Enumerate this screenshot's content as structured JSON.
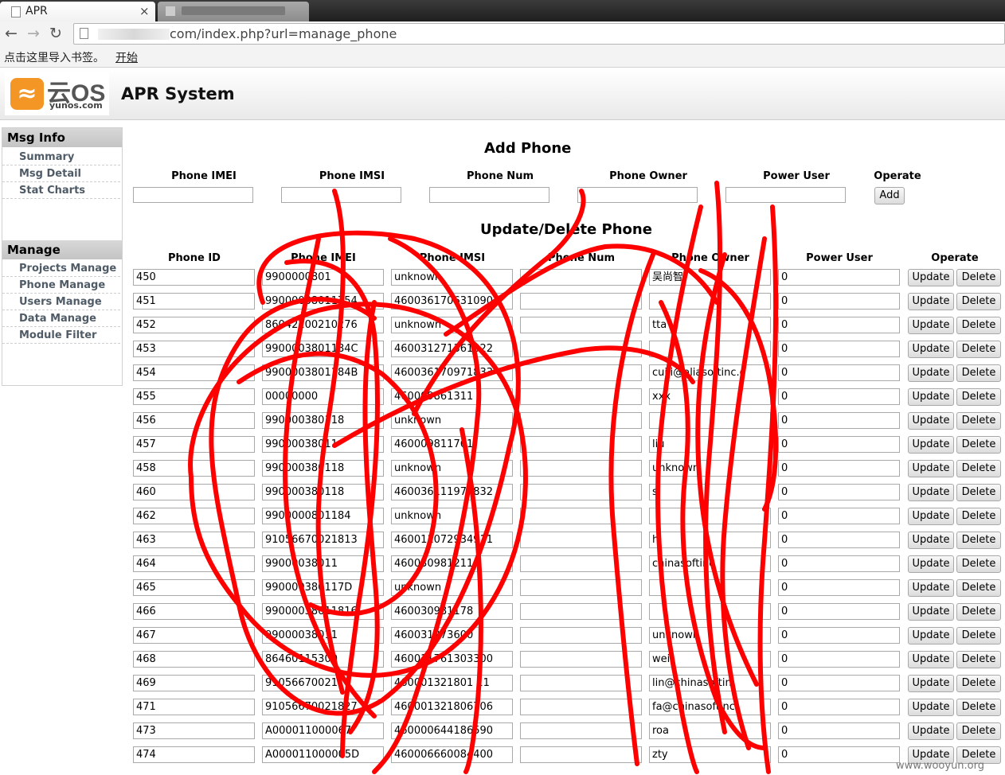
{
  "browser": {
    "tab_title": "APR",
    "tab_close": "×",
    "url": "com/index.php?url=manage_phone",
    "bookmark_prompt": "点击这里导入书签。",
    "bookmark_link": "开始"
  },
  "header": {
    "logo_text": "云OS",
    "logo_sub": "yunos.com",
    "title": "APR System"
  },
  "sidebar": {
    "msg_info_title": "Msg Info",
    "msg_items": [
      "Summary",
      "Msg Detail",
      "Stat Charts"
    ],
    "manage_title": "Manage",
    "manage_items": [
      "Projects Manage",
      "Phone Manage",
      "Users Manage",
      "Data Manage",
      "Module Filter"
    ]
  },
  "add_phone": {
    "title": "Add Phone",
    "columns": [
      "Phone IMEI",
      "Phone IMSI",
      "Phone Num",
      "Phone Owner",
      "Power User",
      "Operate"
    ],
    "add_label": "Add"
  },
  "update_phone": {
    "title": "Update/Delete Phone",
    "columns": [
      "Phone ID",
      "Phone IMEI",
      "Phone IMSI",
      "Phone Num",
      "Phone Owner",
      "Power User",
      "Operate"
    ],
    "update_label": "Update",
    "delete_label": "Delete",
    "rows": [
      {
        "id": "450",
        "imei": "9900000801",
        "imsi": "unknown",
        "num": "",
        "owner": "吴尚智",
        "power": "0"
      },
      {
        "id": "451",
        "imei": "99000038011754",
        "imsi": "460036170631090",
        "num": "",
        "owner": "",
        "power": "0"
      },
      {
        "id": "452",
        "imei": "86042200210276",
        "imsi": "unknown",
        "num": "",
        "owner": "tta",
        "power": "0"
      },
      {
        "id": "453",
        "imei": "9900003801184C",
        "imsi": "460031271361322",
        "num": "",
        "owner": "",
        "power": "0"
      },
      {
        "id": "454",
        "imei": "9900003801184B",
        "imsi": "460036170971833",
        "num": "",
        "owner": "cuiji@aliasoftinc.c",
        "power": "0"
      },
      {
        "id": "455",
        "imei": "00000000",
        "imsi": "460009861311",
        "num": "",
        "owner": "xxx",
        "power": "0"
      },
      {
        "id": "456",
        "imei": "990000380118",
        "imsi": "unknown",
        "num": "",
        "owner": "",
        "power": "0"
      },
      {
        "id": "457",
        "imei": "99000038011",
        "imsi": "460009811761",
        "num": "",
        "owner": "liu",
        "power": "0"
      },
      {
        "id": "458",
        "imei": "990000380118",
        "imsi": "unknown",
        "num": "",
        "owner": "unknown",
        "power": "0"
      },
      {
        "id": "460",
        "imei": "990000380118",
        "imsi": "460036111977832",
        "num": "",
        "owner": "s",
        "power": "0"
      },
      {
        "id": "462",
        "imei": "9900000801184",
        "imsi": "unknown",
        "num": "",
        "owner": "",
        "power": "0"
      },
      {
        "id": "463",
        "imei": "91056670021813",
        "imsi": "460011072934911",
        "num": "",
        "owner": "h",
        "power": "0"
      },
      {
        "id": "464",
        "imei": "99000038011",
        "imsi": "460030981211",
        "num": "",
        "owner": "chinasoftinc",
        "power": "0"
      },
      {
        "id": "465",
        "imei": "990000380117D",
        "imsi": "unknown",
        "num": "",
        "owner": "",
        "power": "0"
      },
      {
        "id": "466",
        "imei": "99000038011816",
        "imsi": "460030981178",
        "num": "",
        "owner": "",
        "power": "0"
      },
      {
        "id": "467",
        "imei": "99000038011",
        "imsi": "460031273600",
        "num": "",
        "owner": "unknown",
        "power": "0"
      },
      {
        "id": "468",
        "imei": "86460115300",
        "imsi": "460011761303300",
        "num": "",
        "owner": "wei",
        "power": "0"
      },
      {
        "id": "469",
        "imei": "91056670021",
        "imsi": "460001321801 11",
        "num": "",
        "owner": "lin@chinasoftin",
        "power": "0"
      },
      {
        "id": "471",
        "imei": "91056670021827",
        "imsi": "460001321806706",
        "num": "",
        "owner": "fa@chinasoftinc",
        "power": "0"
      },
      {
        "id": "473",
        "imei": "A000011000067",
        "imsi": "460000644186590",
        "num": "",
        "owner": "roa",
        "power": "0"
      },
      {
        "id": "474",
        "imei": "A000011000005D",
        "imsi": "460006660084400",
        "num": "",
        "owner": "zty",
        "power": "0"
      }
    ]
  },
  "watermark": "www.wooyun.org",
  "colors": {
    "scribble": "#ff0000",
    "logo_orange": "#f39626"
  }
}
